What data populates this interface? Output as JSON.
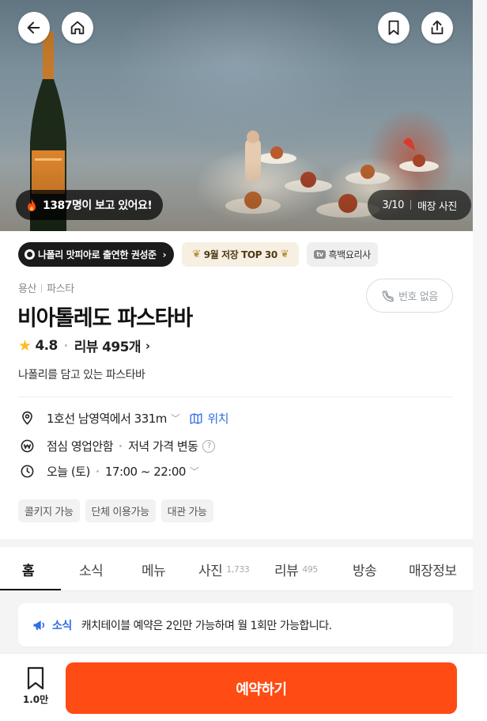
{
  "hero": {
    "viewer_text": "1387명이 보고 있어요!",
    "photo_counter": "3/10",
    "photo_label": "매장 사진"
  },
  "badges": {
    "featured": "나폴리 맛피아로 출연한 권성준",
    "top": "9월 저장 TOP 30",
    "tv_label": "tv",
    "tv": "흑백요리사"
  },
  "store": {
    "region": "용산",
    "category": "파스타",
    "phone_label": "번호 없음",
    "name": "비아톨레도 파스타바",
    "rating": "4.8",
    "review_label": "리뷰 495개",
    "description": "나폴리를 담고 있는 파스타바"
  },
  "info": {
    "location": "1호선 남영역에서 331m",
    "map_label": "위치",
    "service": "점심 영업안함",
    "price_note": "저녁 가격 변동",
    "help_glyph": "?",
    "day": "오늘 (토)",
    "hours": "17:00 ~ 22:00"
  },
  "tags": [
    "콜키지 가능",
    "단체 이용가능",
    "대관 가능"
  ],
  "tabs": [
    {
      "label": "홈",
      "count": ""
    },
    {
      "label": "소식",
      "count": ""
    },
    {
      "label": "메뉴",
      "count": ""
    },
    {
      "label": "사진",
      "count": "1,733"
    },
    {
      "label": "리뷰",
      "count": "495"
    },
    {
      "label": "방송",
      "count": ""
    },
    {
      "label": "매장정보",
      "count": ""
    }
  ],
  "notice": {
    "label": "소식",
    "text": "캐치테이블 예약은 2인만 가능하며 월 1회만 가능합니다."
  },
  "bottom": {
    "save_count": "1.0만",
    "reserve_label": "예약하기"
  },
  "colors": {
    "accent": "#ff4b14",
    "link": "#2e6ee6",
    "star": "#fcbd1d"
  }
}
